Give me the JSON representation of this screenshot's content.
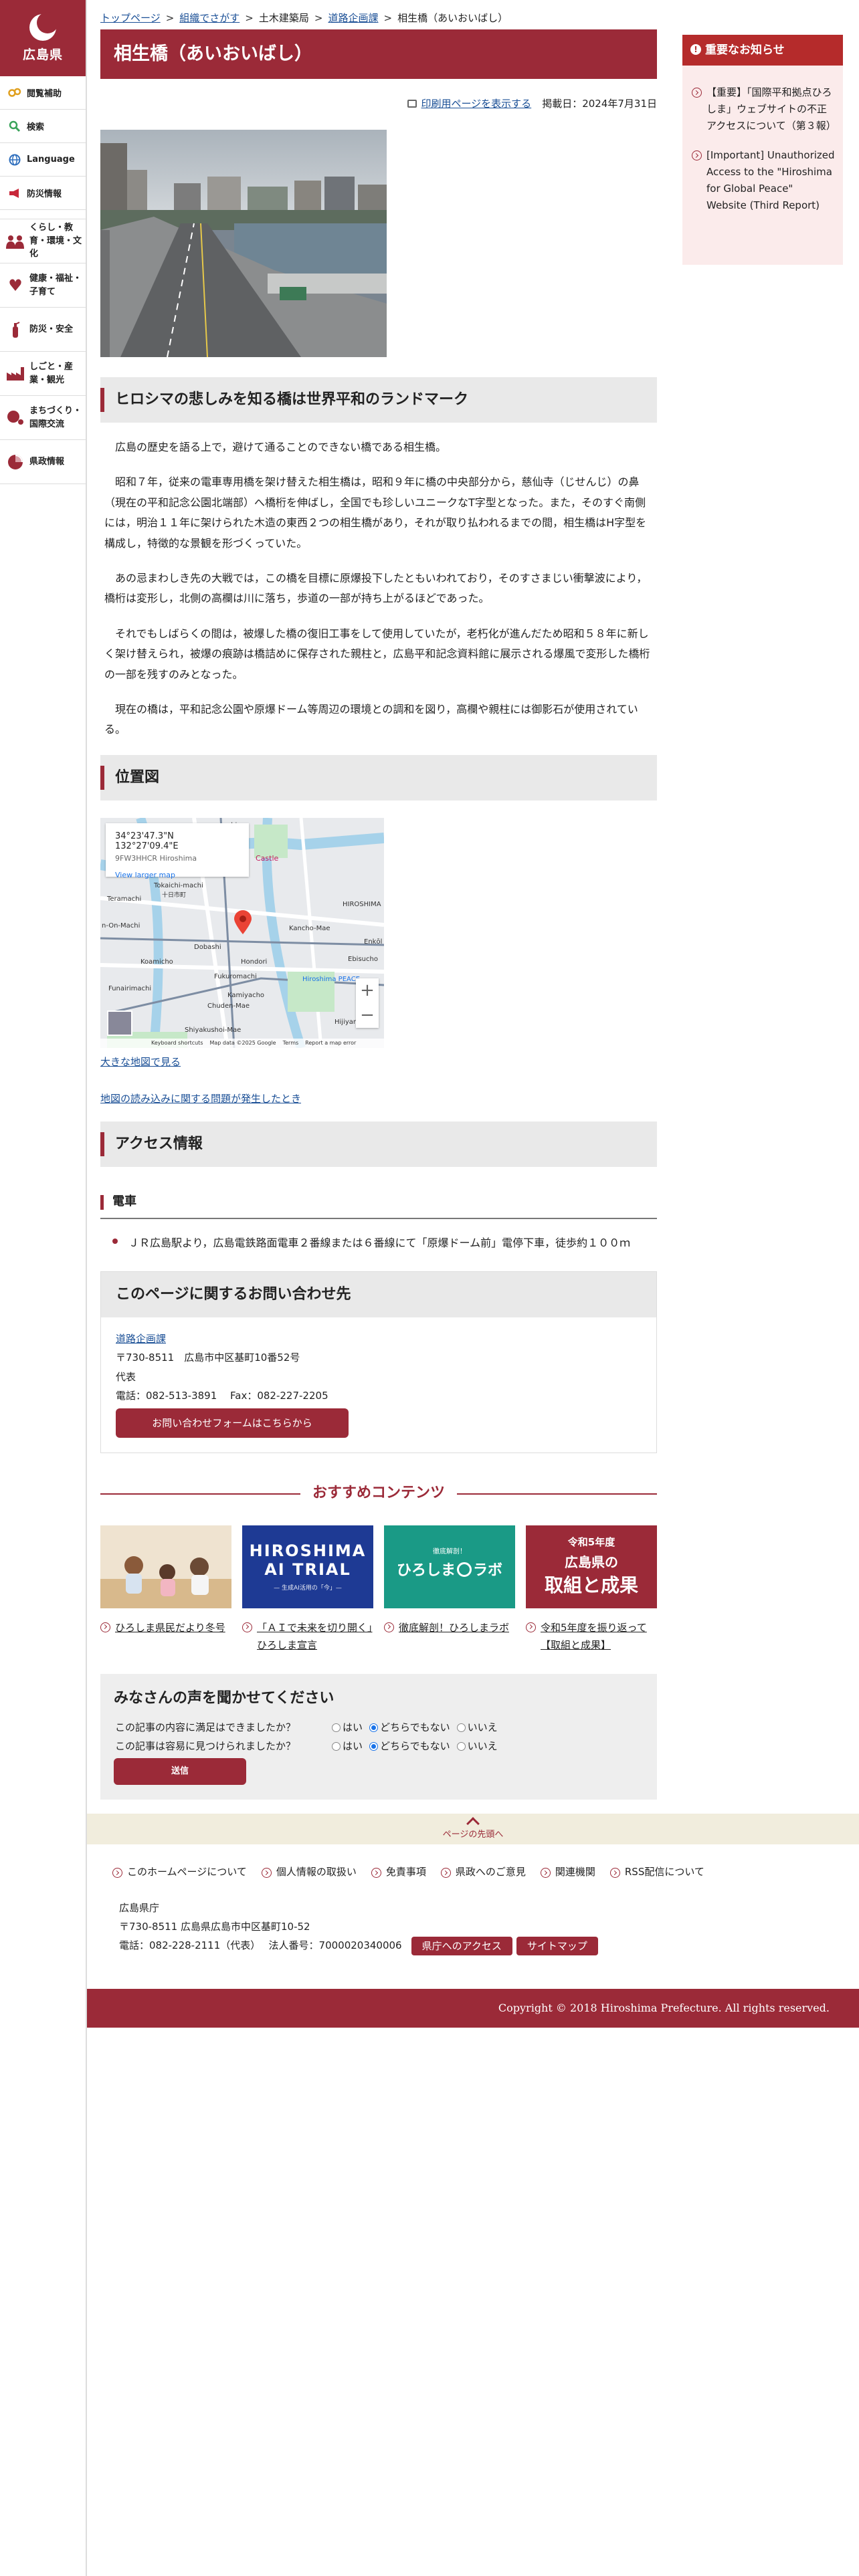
{
  "sidebar": {
    "logo_text": "広島県",
    "utility_items": [
      {
        "label": "閲覧補助",
        "icon": "accessibility-icon"
      },
      {
        "label": "検索",
        "icon": "search-icon"
      },
      {
        "label": "Language",
        "icon": "globe-icon"
      },
      {
        "label": "防災情報",
        "icon": "megaphone-icon"
      }
    ],
    "categories": [
      {
        "label": "くらし・教育・環境・文化",
        "icon": "people-icon"
      },
      {
        "label": "健康・福祉・子育て",
        "icon": "heart-icon"
      },
      {
        "label": "防災・安全",
        "icon": "fire-extinguisher-icon"
      },
      {
        "label": "しごと・産業・観光",
        "icon": "factory-icon"
      },
      {
        "label": "まちづくり・国際交流",
        "icon": "globe-people-icon"
      },
      {
        "label": "県政情報",
        "icon": "pie-chart-icon"
      }
    ]
  },
  "breadcrumb": {
    "items": [
      "トップページ",
      "組織でさがす",
      "土木建築局",
      "道路企画課",
      "相生橋（あいおいばし）"
    ],
    "separator": ">"
  },
  "page": {
    "title": "相生橋（あいおいばし）",
    "print_link": "印刷用ページを表示する",
    "published": "掲載日：2024年7月31日"
  },
  "section1": {
    "heading": "ヒロシマの悲しみを知る橋は世界平和のランドマーク",
    "paragraphs": [
      "広島の歴史を語る上で，避けて通ることのできない橋である相生橋。",
      "昭和７年，従来の電車専用橋を架け替えた相生橋は，昭和９年に橋の中央部分から，慈仙寺（じせんじ）の鼻（現在の平和記念公園北端部）へ橋桁を伸ばし，全国でも珍しいユニークなT字型となった。また，そのすぐ南側には，明治１１年に架けられた木造の東西２つの相生橋があり，それが取り払われるまでの間，相生橋はH字型を構成し，特徴的な景観を形づくっていた。",
      "あの忌まわしき先の大戦では，この橋を目標に原爆投下したともいわれており，そのすさまじい衝撃波により，橋桁は変形し，北側の高欄は川に落ち，歩道の一部が持ち上がるほどであった。",
      "それでもしばらくの間は，被爆した橋の復旧工事をして使用していたが，老朽化が進んだため昭和５８年に新しく架け替えられ，被爆の痕跡は橋詰めに保存された親柱と，広島平和記念資料館に展示される爆風で変形した橋桁の一部を残すのみとなった。",
      "現在の橋は，平和記念公園や原爆ドーム等周辺の環境との調和を図り，高欄や親柱には御影石が使用されている。"
    ]
  },
  "location": {
    "heading": "位置図",
    "map": {
      "coords": "34°23'47.3\"N 132°27'09.4\"E",
      "plus_code": "9FW3HHCR Hiroshima",
      "view_larger": "View larger map",
      "labels": [
        "Castle",
        "Tokaichi-machi",
        "十日市町",
        "Kancho-Mae",
        "HIROSHIMA",
        "Ebisucho",
        "Dobashi",
        "Hondori",
        "Fukuromachi",
        "Funairimachi",
        "Chuden-Mae",
        "Hiroshima PEACE",
        "Shiyakushoi-Mae",
        "Enkōl",
        "Hijiyar",
        "Koamicho",
        "Kamiyacho",
        "Teramachi",
        "n-On-Machi",
        "shima"
      ],
      "footer": [
        "Keyboard shortcuts",
        "Map data ©2025 Google",
        "Terms",
        "Report a map error"
      ],
      "zoom_in": "+",
      "zoom_out": "−"
    },
    "larger_map_link": "大きな地図で見る",
    "problem_link": "地図の読み込みに関する問題が発生したとき"
  },
  "access": {
    "heading": "アクセス情報",
    "subheading": "電車",
    "items": [
      "ＪＲ広島駅より，広島電鉄路面電車２番線または６番線にて「原爆ドーム前」電停下車，徒歩約１００ｍ"
    ]
  },
  "inquiry": {
    "heading": "このページに関するお問い合わせ先",
    "dept": "道路企画課",
    "address": "〒730-8511　広島市中区基町10番52号",
    "rep": "代表",
    "phone": "電話：082-513-3891　 Fax：082-227-2205",
    "button": "お問い合わせフォームはこちらから"
  },
  "recommended": {
    "heading": "おすすめコンテンツ",
    "items": [
      {
        "label": "ひろしま県民だより冬号"
      },
      {
        "label": "「ＡＩで未来を切り開く」ひろしま宣言",
        "banner_title": "HIROSHIMA",
        "banner_title2": "AI TRIAL",
        "banner_sub": "— 生成AI活用の「今」—"
      },
      {
        "label": "徹底解剖！ひろしまラボ",
        "banner_small": "徹底解剖！",
        "banner_main": "ひろしま",
        "banner_suffix": "ラボ"
      },
      {
        "label": "令和5年度を振り返って【取組と成果】",
        "banner_l1": "令和5年度",
        "banner_l2": "広島県の",
        "banner_l3": "取組と成果"
      }
    ]
  },
  "survey": {
    "heading": "みなさんの声を聞かせてください",
    "questions": [
      {
        "text": "この記事の内容に満足はできましたか？",
        "options": [
          "はい",
          "どちらでもない",
          "いいえ"
        ],
        "selected": "どちらでもない"
      },
      {
        "text": "この記事は容易に見つけられましたか？",
        "options": [
          "はい",
          "どちらでもない",
          "いいえ"
        ],
        "selected": "どちらでもない"
      }
    ],
    "submit": "送信"
  },
  "notice": {
    "heading": "重要なお知らせ",
    "items": [
      "【重要】「国際平和拠点ひろしま」ウェブサイトの不正アクセスについて（第３報）",
      "[Important] Unauthorized Access to the \"Hiroshima for Global Peace\" Website (Third Report)"
    ]
  },
  "footer": {
    "page_top": "ページの先頭へ",
    "links": [
      "このホームページについて",
      "個人情報の取扱い",
      "免責事項",
      "県政へのご意見",
      "関連機関",
      "RSS配信について"
    ],
    "org": "広島県庁",
    "address": "〒730-8511 広島県広島市中区基町10-52",
    "phone": "電話：082-228-2111（代表）　 法人番号：7000020340006",
    "buttons": [
      "県庁へのアクセス",
      "サイトマップ"
    ],
    "copyright": "Copyright © 2018 Hiroshima Prefecture. All rights reserved."
  },
  "colors": {
    "brand": "#9b2a38",
    "notice": "#b52b2b",
    "link": "#1a4f96"
  }
}
